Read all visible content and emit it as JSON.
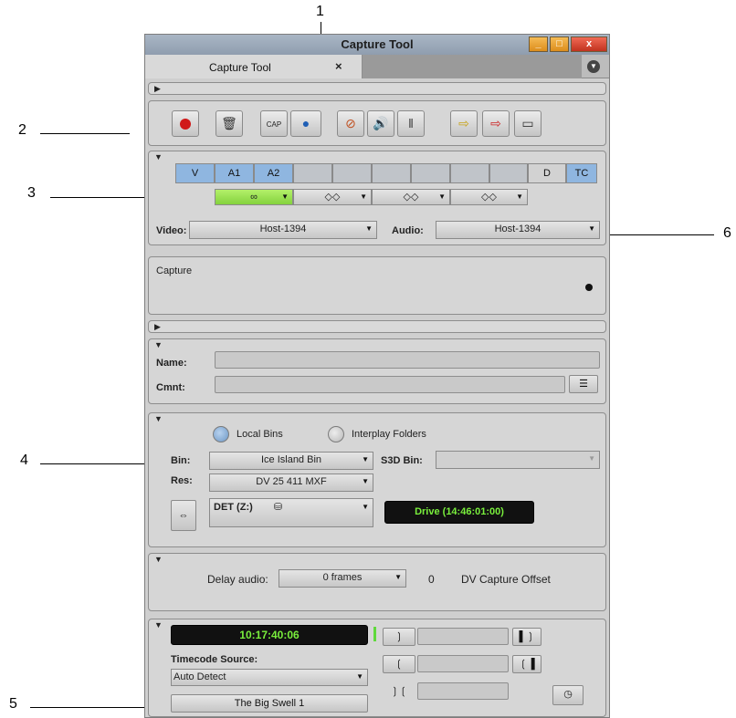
{
  "window": {
    "title": "Capture Tool",
    "tab_label": "Capture Tool",
    "tab_close": "×",
    "min_glyph": "_",
    "max_glyph": "□",
    "close_glyph": "x"
  },
  "annotations": {
    "n1": "1",
    "n2": "2",
    "n3": "3",
    "n4": "4",
    "n5": "5",
    "n6": "6"
  },
  "toolbar": {
    "cap_label": "CAP"
  },
  "tracks": {
    "v": "V",
    "a1": "A1",
    "a2": "A2",
    "d": "D",
    "tc": "TC",
    "pair1": "∞",
    "pair2": "◇◇",
    "pair3": "◇◇",
    "pair4": "◇◇"
  },
  "io": {
    "video_label": "Video:",
    "video_value": "Host-1394",
    "audio_label": "Audio:",
    "audio_value": "Host-1394"
  },
  "capture_panel": {
    "label": "Capture"
  },
  "name_panel": {
    "name_label": "Name:",
    "name_value": "",
    "cmnt_label": "Cmnt:",
    "cmnt_value": ""
  },
  "bin_panel": {
    "local_bins": "Local Bins",
    "interplay_folders": "Interplay Folders",
    "bin_label": "Bin:",
    "bin_value": "Ice Island Bin",
    "s3d_label": "S3D Bin:",
    "s3d_value": "",
    "res_label": "Res:",
    "res_value": "DV 25 411  MXF",
    "drive_value": "DET (Z:)",
    "drive_status": "Drive (14:46:01:00)"
  },
  "delay_panel": {
    "delay_label": "Delay audio:",
    "delay_value": "0 frames",
    "offset_value": "0",
    "offset_label": "DV Capture Offset"
  },
  "timecode_panel": {
    "timecode": "10:17:40:06",
    "source_label": "Timecode Source:",
    "source_value": "Auto Detect",
    "tape_name": "The Big Swell 1"
  }
}
